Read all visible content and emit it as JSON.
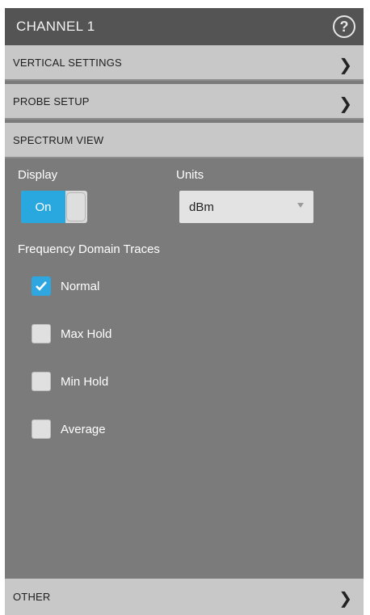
{
  "header": {
    "title": "CHANNEL 1",
    "help_icon": "help-icon"
  },
  "sections": {
    "vertical_settings": "VERTICAL SETTINGS",
    "probe_setup": "PROBE SETUP",
    "spectrum_view": "SPECTRUM VIEW",
    "other": "OTHER"
  },
  "spectrum": {
    "display_label": "Display",
    "display_toggle_value": "On",
    "units_label": "Units",
    "units_value": "dBm",
    "traces_label": "Frequency Domain Traces",
    "traces": [
      {
        "label": "Normal",
        "checked": true
      },
      {
        "label": "Max Hold",
        "checked": false
      },
      {
        "label": "Min Hold",
        "checked": false
      },
      {
        "label": "Average",
        "checked": false
      }
    ]
  },
  "colors": {
    "accent": "#29a8e0",
    "panel_bg": "#7b7b7b",
    "title_bg": "#545454",
    "section_bg": "#c8c8c8"
  }
}
